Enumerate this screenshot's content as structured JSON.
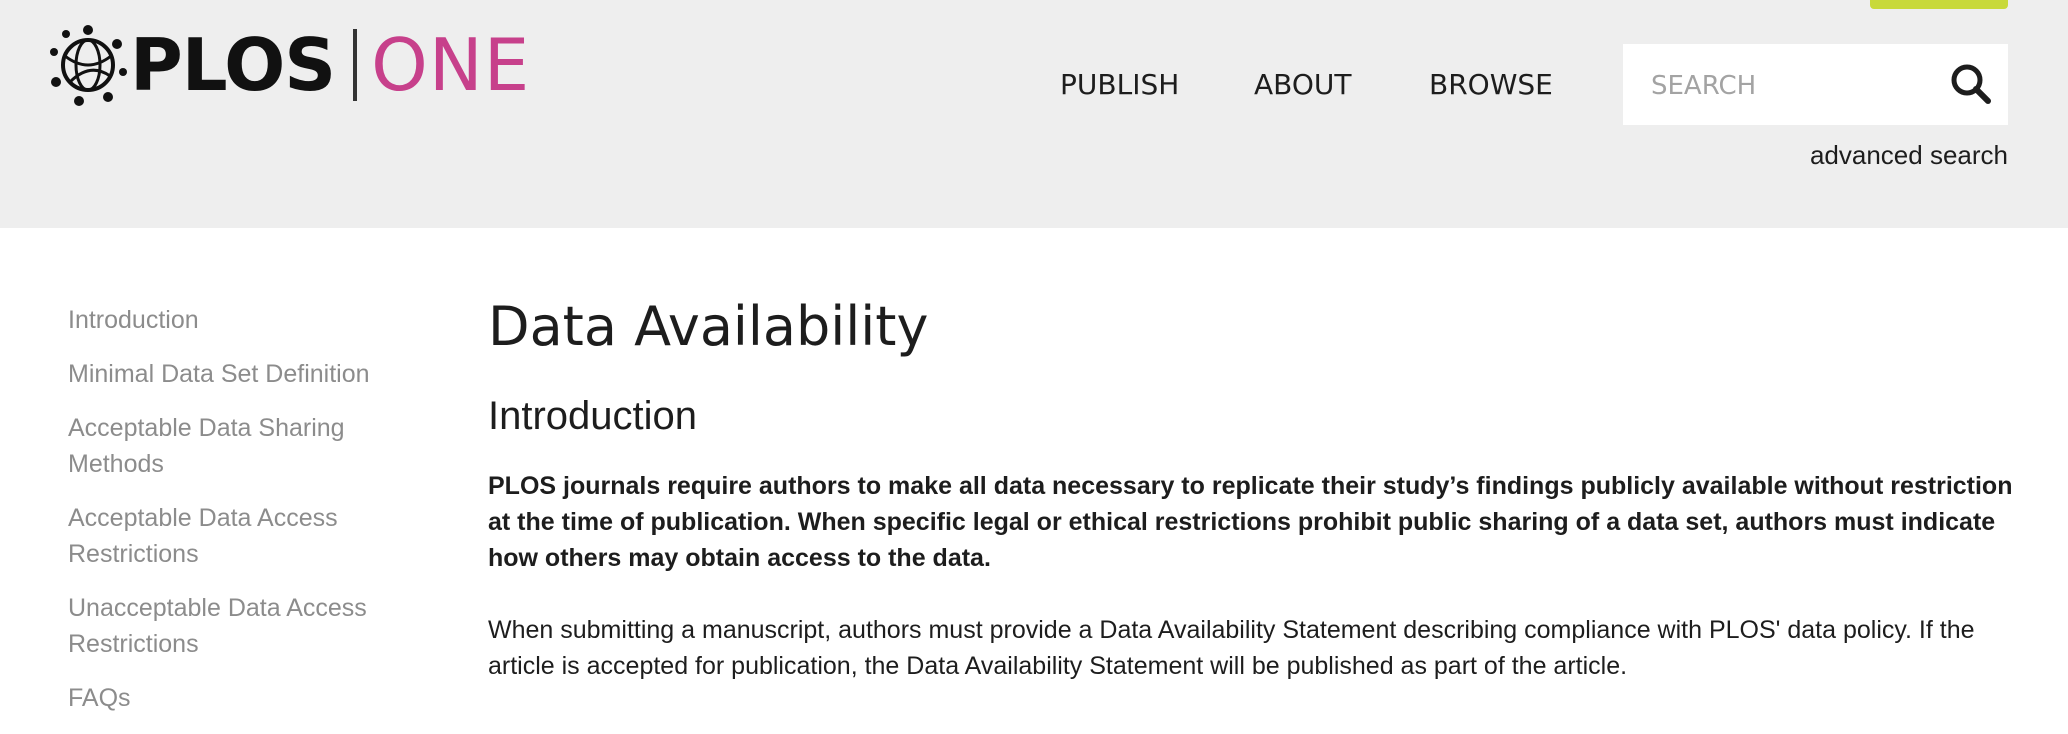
{
  "header": {
    "logo": {
      "brand": "PLOS",
      "journal": "ONE",
      "brand_color": "#111111",
      "journal_color": "#c7408b",
      "icon": "plos-globe-icon"
    },
    "accent_color": "#c8d93a",
    "background": "#eeeeee",
    "nav": [
      {
        "label": "PUBLISH"
      },
      {
        "label": "ABOUT"
      },
      {
        "label": "BROWSE"
      }
    ],
    "search": {
      "placeholder": "SEARCH",
      "value": "",
      "icon": "search-icon"
    },
    "advanced_search_label": "advanced search"
  },
  "sidebar": {
    "items": [
      {
        "label": "Introduction"
      },
      {
        "label": "Minimal Data Set Definition"
      },
      {
        "label": "Acceptable Data Sharing Methods"
      },
      {
        "label": "Acceptable Data Access Restrictions"
      },
      {
        "label": "Unacceptable Data Access Restrictions"
      },
      {
        "label": "FAQs"
      }
    ],
    "text_color": "#8c8c8c"
  },
  "main": {
    "title": "Data Availability",
    "section_heading": "Introduction",
    "lead": "PLOS journals require authors to make all data necessary to replicate their study’s findings publicly available without restriction at the time of publication. When specific legal or ethical restrictions prohibit public sharing of a data set, authors must indicate how others may obtain access to the data.",
    "paragraph": "When submitting a manuscript, authors must provide a Data Availability Statement describing compliance with PLOS' data policy. If the article is accepted for publication, the Data Availability Statement will be published as part of the article."
  }
}
